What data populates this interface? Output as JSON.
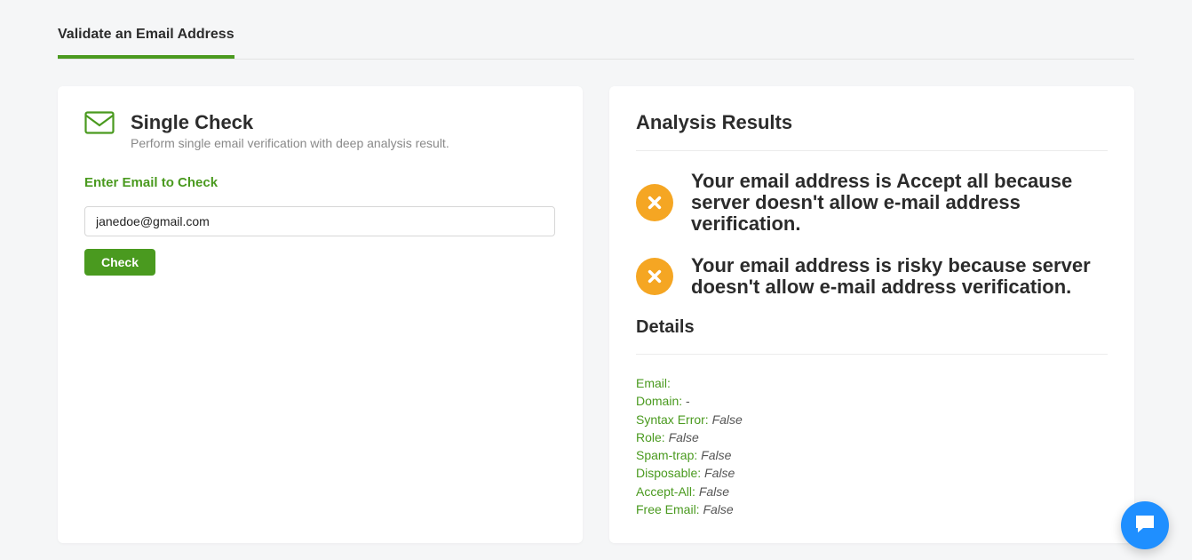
{
  "tab": {
    "label": "Validate an Email Address"
  },
  "left": {
    "title": "Single Check",
    "subtitle": "Perform single email verification with deep analysis result.",
    "field_label": "Enter Email to Check",
    "email_value": "janedoe@gmail.com",
    "check_label": "Check"
  },
  "right": {
    "title": "Analysis Results",
    "messages": [
      "Your email address is Accept all because server doesn't allow e-mail address verification.",
      "Your email address is risky because server doesn't allow e-mail address verification."
    ],
    "details_title": "Details",
    "details": {
      "email_label": "Email:",
      "email_value": "",
      "domain_label": "Domain:",
      "domain_value": "-",
      "syntax_label": "Syntax Error:",
      "syntax_value": "False",
      "role_label": "Role:",
      "role_value": "False",
      "spam_label": "Spam-trap:",
      "spam_value": "False",
      "disp_label": "Disposable:",
      "disp_value": "False",
      "accept_label": "Accept-All:",
      "accept_value": "False",
      "free_label": "Free Email:",
      "free_value": "False"
    }
  },
  "icons": {
    "envelope": "envelope-icon",
    "cross": "cross-circle-icon",
    "chat": "chat-icon"
  },
  "colors": {
    "accent": "#4a9a1f",
    "warn": "#f5a623",
    "chat": "#1f8fff"
  }
}
